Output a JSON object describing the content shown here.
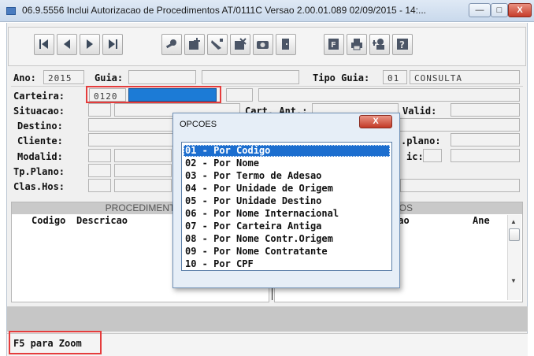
{
  "window": {
    "title": "06.9.5556   Inclui  Autorizacao de Procedimentos AT/0111C Versao 2.00.01.089 02/09/2015 - 14:...",
    "min_glyph": "—",
    "max_glyph": "□",
    "close_glyph": "X"
  },
  "toolbar": {
    "buttons": [
      "first-record-icon",
      "previous-record-icon",
      "next-record-icon",
      "last-record-icon",
      "search-person-icon",
      "add-icon",
      "edit-icon",
      "delete-icon",
      "camera-icon",
      "exit-door-icon",
      "filter-icon",
      "print-icon",
      "user-add-icon",
      "help-icon"
    ]
  },
  "header": {
    "ano_label": "Ano:",
    "ano_value": "2015",
    "guia_label": "Guia:",
    "guia_value": "",
    "tipo_guia_label": "Tipo Guia:",
    "tipo_guia_code": "01",
    "tipo_guia_desc": "CONSULTA"
  },
  "form": {
    "carteira_label": "Carteira:",
    "carteira_value": "0120",
    "situacao_label": "Situacao:",
    "cart_ant_label": "Cart. Ant.:",
    "valid_label": "Valid:",
    "destino_label": "Destino:",
    "cliente_label": "Cliente:",
    "plano_label": ".plano:",
    "modalid_label": "Modalid:",
    "ic_label": "ic:",
    "tp_plano_label": "Tp.Plano:",
    "clas_hos_label": "Clas.Hos:"
  },
  "grid_left": {
    "header": "PROCEDIMENT",
    "col_codigo": "Codigo",
    "col_descricao": "Descricao"
  },
  "grid_right": {
    "header": "UMOS",
    "col_cao": "cao",
    "col_ane": "Ane"
  },
  "dialog": {
    "title": "OPCOES",
    "close": "X",
    "options": [
      "01 - Por Codigo",
      "02 - Por Nome",
      "03 - Por Termo de Adesao",
      "04 - Por Unidade de Origem",
      "05 - Por Unidade Destino",
      "06 - Por Nome Internacional",
      "07 - Por Carteira Antiga",
      "08 - Por Nome Contr.Origem",
      "09 - Por Nome Contratante",
      "10 - Por CPF"
    ],
    "selected_index": 0
  },
  "status": {
    "hint": "F5 para Zoom"
  },
  "colors": {
    "selection": "#1c6ecf",
    "highlight_border": "#e53c3c"
  }
}
